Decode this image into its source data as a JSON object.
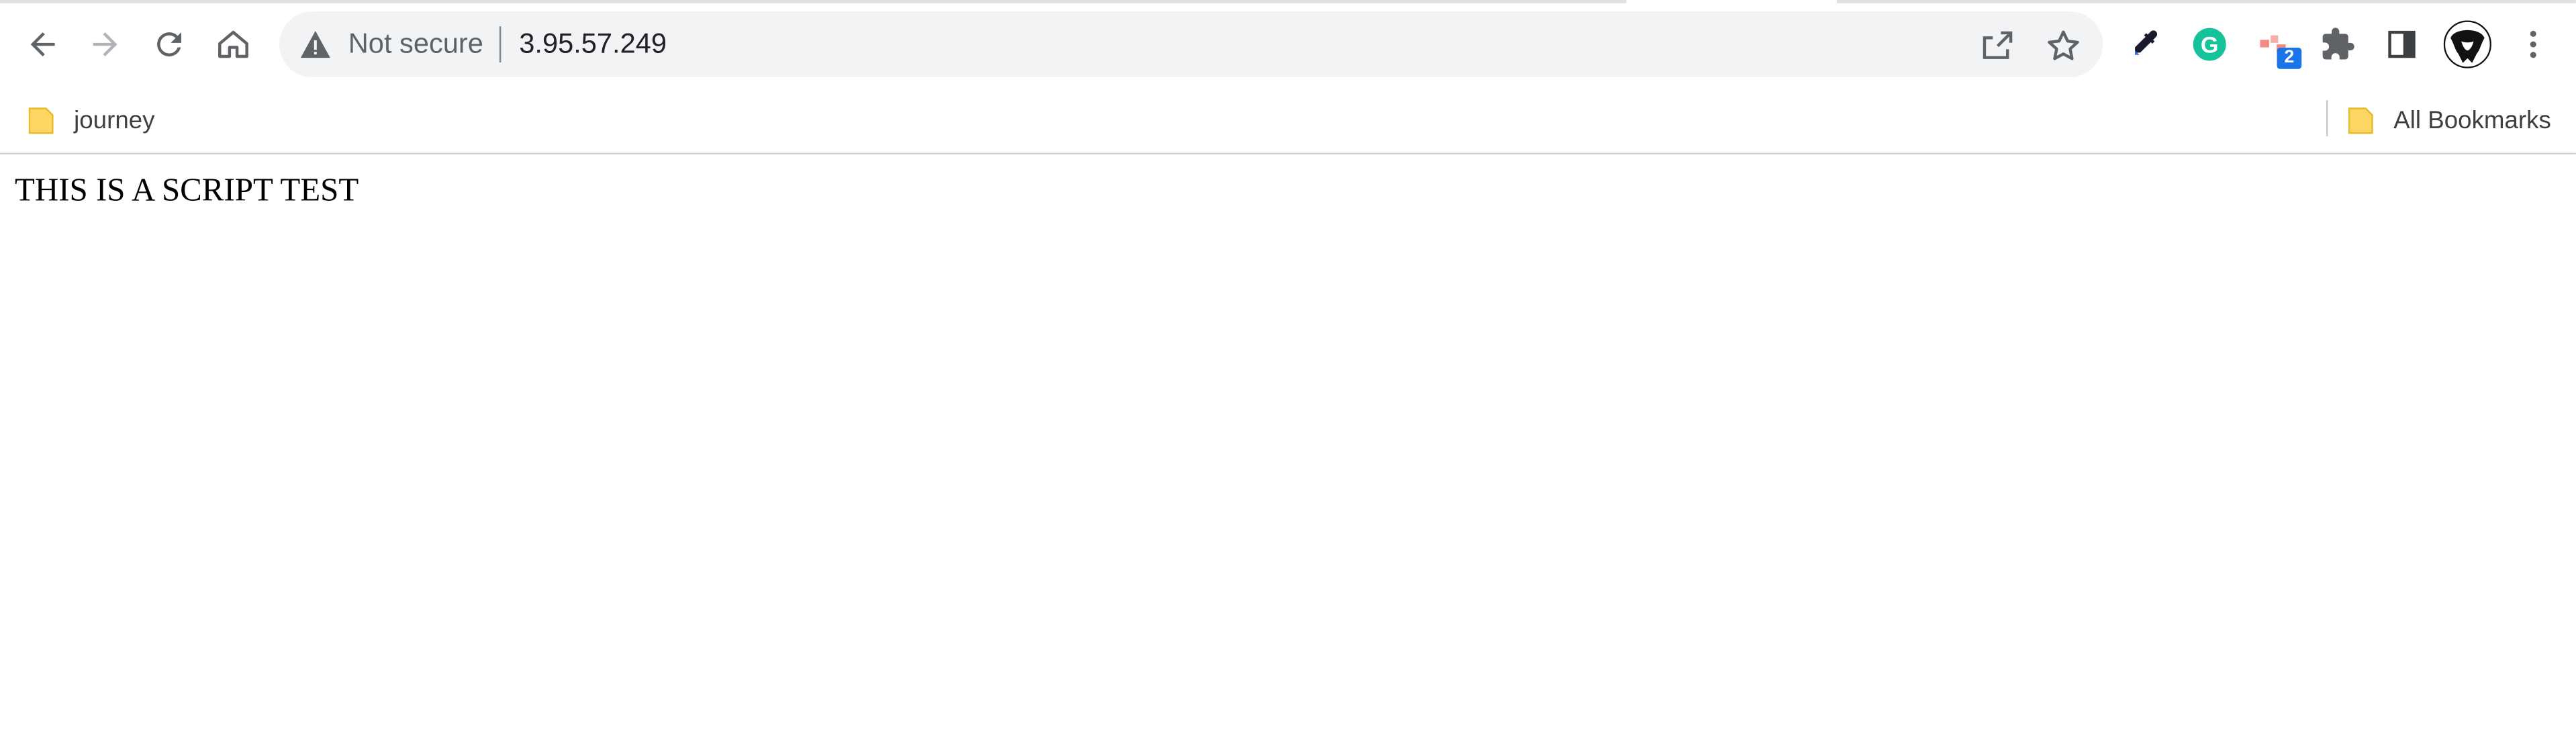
{
  "browser": {
    "omnibox": {
      "security_label": "Not secure",
      "url": "3.95.57.249"
    },
    "extensions": [
      {
        "name": "eyedropper-icon"
      },
      {
        "name": "grammarly-icon",
        "glyph": "G",
        "color": "#15c39a"
      },
      {
        "name": "extension-with-badge-icon",
        "badge": "2"
      },
      {
        "name": "puzzle-icon"
      },
      {
        "name": "side-panel-icon"
      },
      {
        "name": "profile-avatar"
      },
      {
        "name": "kebab-menu-icon"
      }
    ]
  },
  "bookmarks": {
    "items": [
      {
        "label": "journey",
        "icon": "folder-icon"
      }
    ],
    "all_bookmarks": {
      "label": "All Bookmarks",
      "icon": "folder-icon"
    }
  },
  "page": {
    "heading": "THIS IS A SCRIPT TEST"
  },
  "colors": {
    "folder": "#fdd663",
    "badge": "#1a73e8",
    "grammarly": "#15c39a"
  }
}
